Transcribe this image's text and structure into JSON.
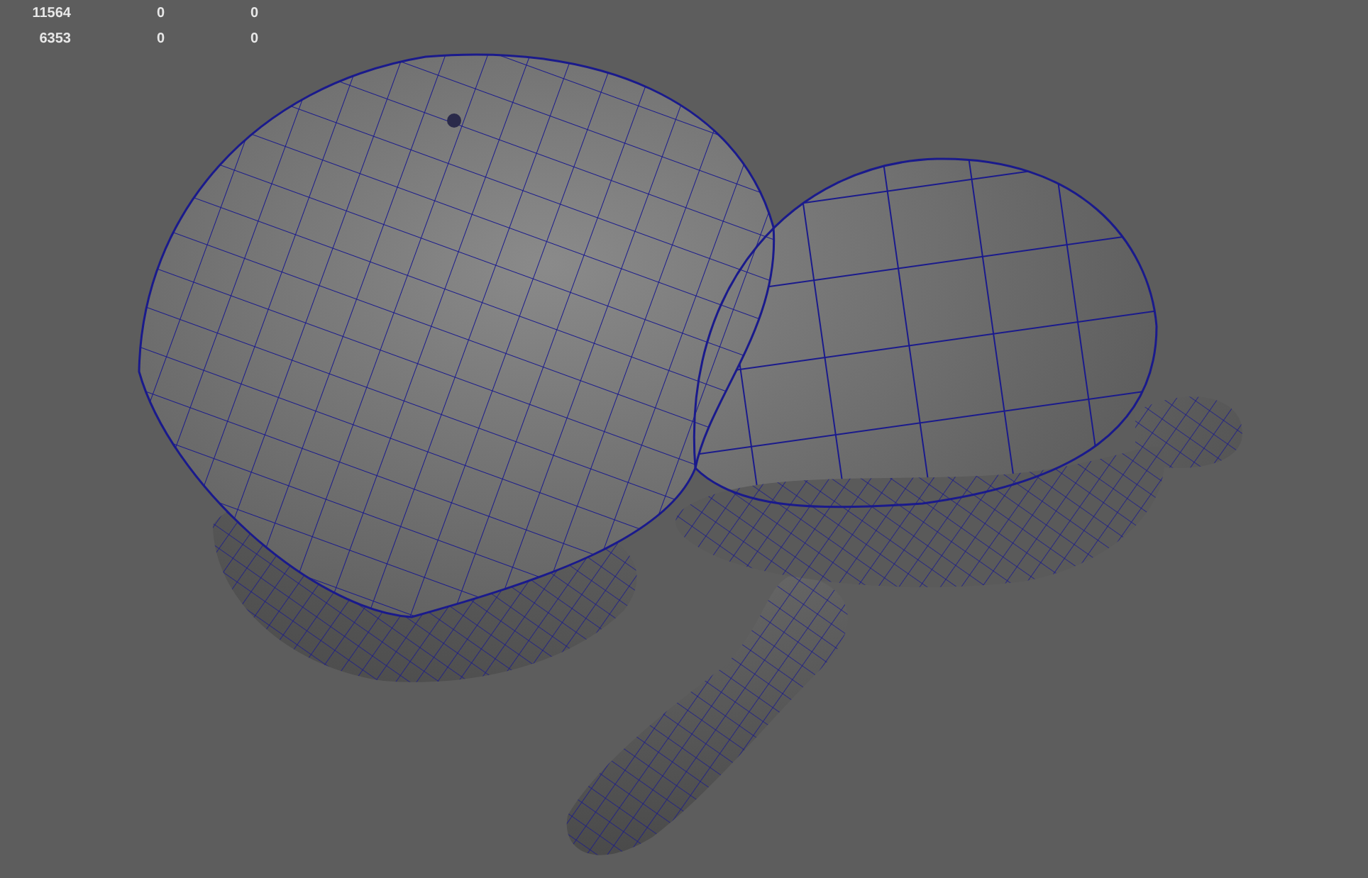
{
  "viewport": {
    "hud_rows": [
      {
        "cells": [
          "11564",
          "0",
          "0"
        ]
      },
      {
        "cells": [
          "6353",
          "0",
          "0"
        ]
      }
    ]
  }
}
